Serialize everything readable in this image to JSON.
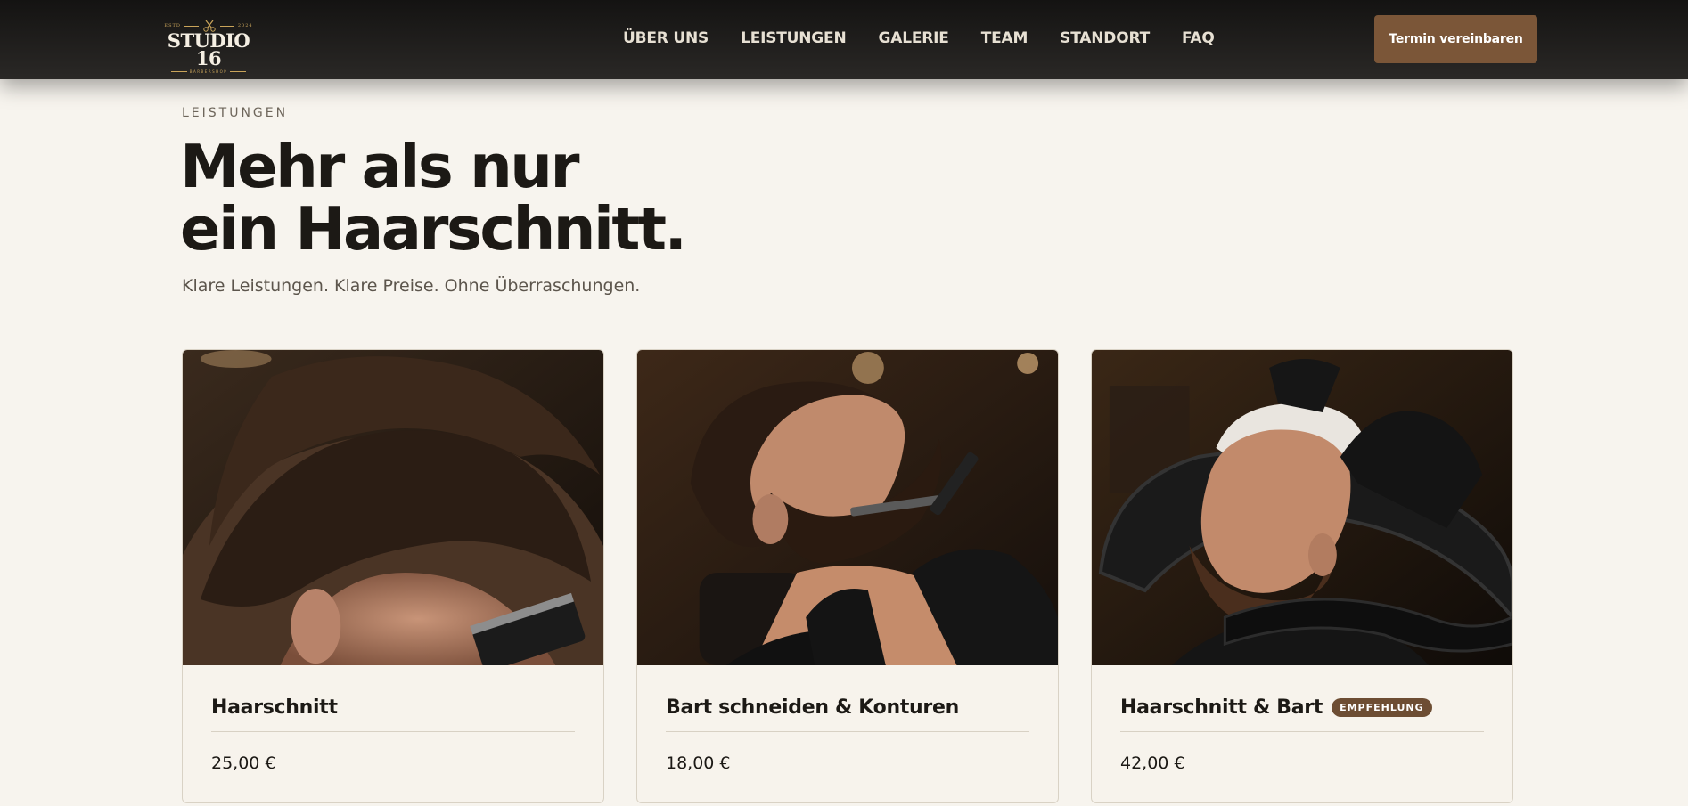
{
  "header": {
    "logo": {
      "name": "STUDIO 16",
      "top_left": "ESTD",
      "top_right": "2024",
      "sub": "BARBERSHOP"
    },
    "nav": [
      "ÜBER UNS",
      "LEISTUNGEN",
      "GALERIE",
      "TEAM",
      "STANDORT",
      "FAQ"
    ],
    "cta_label": "Termin vereinbaren"
  },
  "hero": {
    "eyebrow": "LEISTUNGEN",
    "headline_line1": "Mehr als nur",
    "headline_line2": "ein Haarschnitt.",
    "subline": "Klare Leistungen. Klare Preise. Ohne Überraschungen."
  },
  "services": [
    {
      "title": "Haarschnitt",
      "price": "25,00 €",
      "badge": "",
      "image": "haircut-fade-photo"
    },
    {
      "title": "Bart schneiden & Konturen",
      "price": "18,00 €",
      "badge": "",
      "image": "beard-shave-photo"
    },
    {
      "title": "Haarschnitt & Bart",
      "price": "42,00 €",
      "badge": "EMPFEHLUNG",
      "image": "hair-wash-photo"
    }
  ],
  "colors": {
    "header_bg": "#1e1d1b",
    "accent": "#7b5638",
    "page_bg": "#f7f4ee",
    "text": "#1c1915"
  }
}
